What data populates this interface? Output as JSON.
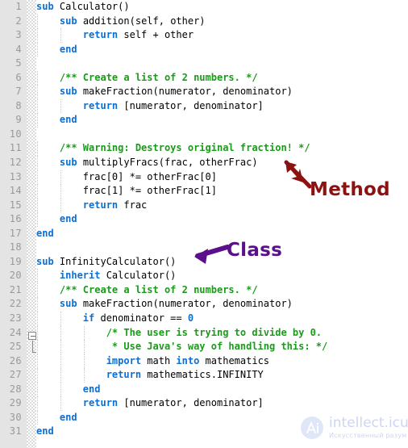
{
  "editor": {
    "language_hint": "pseudocode",
    "total_lines": 31,
    "colors": {
      "background": "#ffffff",
      "gutter_background": "#e4e4e4",
      "line_number": "#999999",
      "keyword": "#0b6fd4",
      "comment": "#1a9b1a",
      "number": "#0b6fd4",
      "identifier": "#000000",
      "indent_guide": "#c9c9c9",
      "annotation_method": "#8c1111",
      "annotation_class": "#5c0f8b",
      "watermark": "#ccd6f2"
    }
  },
  "line_numbers": [
    "1",
    "2",
    "3",
    "4",
    "5",
    "6",
    "7",
    "8",
    "9",
    "10",
    "11",
    "12",
    "13",
    "14",
    "15",
    "16",
    "17",
    "18",
    "19",
    "20",
    "21",
    "22",
    "23",
    "24",
    "25",
    "26",
    "27",
    "28",
    "29",
    "30",
    "31"
  ],
  "code_lines": [
    {
      "n": 1,
      "indent": 0,
      "guides": [],
      "tokens": [
        {
          "t": "kw",
          "v": "sub"
        },
        {
          "t": "id",
          "v": " Calculator()"
        }
      ]
    },
    {
      "n": 2,
      "indent": 1,
      "guides": [
        0
      ],
      "tokens": [
        {
          "t": "kw",
          "v": "sub"
        },
        {
          "t": "id",
          "v": " addition(self, other)"
        }
      ]
    },
    {
      "n": 3,
      "indent": 2,
      "guides": [
        0,
        1
      ],
      "tokens": [
        {
          "t": "kw",
          "v": "return"
        },
        {
          "t": "id",
          "v": " self + other"
        }
      ]
    },
    {
      "n": 4,
      "indent": 1,
      "guides": [
        0
      ],
      "tokens": [
        {
          "t": "kw",
          "v": "end"
        }
      ]
    },
    {
      "n": 5,
      "indent": 0,
      "guides": [],
      "tokens": []
    },
    {
      "n": 6,
      "indent": 1,
      "guides": [
        0
      ],
      "tokens": [
        {
          "t": "cm",
          "v": "/** Create a list of 2 numbers. */"
        }
      ]
    },
    {
      "n": 7,
      "indent": 1,
      "guides": [
        0
      ],
      "tokens": [
        {
          "t": "kw",
          "v": "sub"
        },
        {
          "t": "id",
          "v": " makeFraction(numerator, denominator)"
        }
      ]
    },
    {
      "n": 8,
      "indent": 2,
      "guides": [
        0,
        1
      ],
      "tokens": [
        {
          "t": "kw",
          "v": "return"
        },
        {
          "t": "id",
          "v": " [numerator, denominator]"
        }
      ]
    },
    {
      "n": 9,
      "indent": 1,
      "guides": [
        0
      ],
      "tokens": [
        {
          "t": "kw",
          "v": "end"
        }
      ]
    },
    {
      "n": 10,
      "indent": 0,
      "guides": [],
      "tokens": []
    },
    {
      "n": 11,
      "indent": 1,
      "guides": [
        0
      ],
      "tokens": [
        {
          "t": "cm",
          "v": "/** Warning: Destroys original fraction! */"
        }
      ]
    },
    {
      "n": 12,
      "indent": 1,
      "guides": [
        0
      ],
      "tokens": [
        {
          "t": "kw",
          "v": "sub"
        },
        {
          "t": "id",
          "v": " multiplyFracs(frac, otherFrac)"
        }
      ]
    },
    {
      "n": 13,
      "indent": 2,
      "guides": [
        0,
        1
      ],
      "tokens": [
        {
          "t": "id",
          "v": "frac[0] *= otherFrac[0]"
        }
      ]
    },
    {
      "n": 14,
      "indent": 2,
      "guides": [
        0,
        1
      ],
      "tokens": [
        {
          "t": "id",
          "v": "frac[1] *= otherFrac[1]"
        }
      ]
    },
    {
      "n": 15,
      "indent": 2,
      "guides": [
        0,
        1
      ],
      "tokens": [
        {
          "t": "kw",
          "v": "return"
        },
        {
          "t": "id",
          "v": " frac"
        }
      ]
    },
    {
      "n": 16,
      "indent": 1,
      "guides": [
        0
      ],
      "tokens": [
        {
          "t": "kw",
          "v": "end"
        }
      ]
    },
    {
      "n": 17,
      "indent": 0,
      "guides": [],
      "tokens": [
        {
          "t": "kw",
          "v": "end"
        }
      ]
    },
    {
      "n": 18,
      "indent": 0,
      "guides": [],
      "tokens": []
    },
    {
      "n": 19,
      "indent": 0,
      "guides": [],
      "tokens": [
        {
          "t": "kw",
          "v": "sub"
        },
        {
          "t": "id",
          "v": " InfinityCalculator()"
        }
      ]
    },
    {
      "n": 20,
      "indent": 1,
      "guides": [
        0
      ],
      "tokens": [
        {
          "t": "kw",
          "v": "inherit"
        },
        {
          "t": "id",
          "v": " Calculator()"
        }
      ]
    },
    {
      "n": 21,
      "indent": 1,
      "guides": [
        0
      ],
      "tokens": [
        {
          "t": "cm",
          "v": "/** Create a list of 2 numbers. */"
        }
      ]
    },
    {
      "n": 22,
      "indent": 1,
      "guides": [
        0
      ],
      "tokens": [
        {
          "t": "kw",
          "v": "sub"
        },
        {
          "t": "id",
          "v": " makeFraction(numerator, denominator)"
        }
      ]
    },
    {
      "n": 23,
      "indent": 2,
      "guides": [
        0,
        1
      ],
      "tokens": [
        {
          "t": "kw",
          "v": "if"
        },
        {
          "t": "id",
          "v": " denominator == "
        },
        {
          "t": "num",
          "v": "0"
        }
      ]
    },
    {
      "n": 24,
      "indent": 3,
      "guides": [
        0,
        1,
        2
      ],
      "tokens": [
        {
          "t": "cm",
          "v": "/* The user is trying to divide by 0."
        }
      ]
    },
    {
      "n": 25,
      "indent": 3,
      "guides": [
        0,
        1,
        2
      ],
      "tokens": [
        {
          "t": "cm",
          "v": " * Use Java's way of handling this: */"
        }
      ]
    },
    {
      "n": 26,
      "indent": 3,
      "guides": [
        0,
        1,
        2
      ],
      "tokens": [
        {
          "t": "kw",
          "v": "import"
        },
        {
          "t": "id",
          "v": " math "
        },
        {
          "t": "kw",
          "v": "into"
        },
        {
          "t": "id",
          "v": " mathematics"
        }
      ]
    },
    {
      "n": 27,
      "indent": 3,
      "guides": [
        0,
        1,
        2
      ],
      "tokens": [
        {
          "t": "kw",
          "v": "return"
        },
        {
          "t": "id",
          "v": " mathematics.INFINITY"
        }
      ]
    },
    {
      "n": 28,
      "indent": 2,
      "guides": [
        0,
        1
      ],
      "tokens": [
        {
          "t": "kw",
          "v": "end"
        }
      ]
    },
    {
      "n": 29,
      "indent": 2,
      "guides": [
        0,
        1
      ],
      "tokens": [
        {
          "t": "kw",
          "v": "return"
        },
        {
          "t": "id",
          "v": " [numerator, denominator]"
        }
      ]
    },
    {
      "n": 30,
      "indent": 1,
      "guides": [
        0
      ],
      "tokens": [
        {
          "t": "kw",
          "v": "end"
        }
      ]
    },
    {
      "n": 31,
      "indent": 0,
      "guides": [],
      "tokens": [
        {
          "t": "kw",
          "v": "end"
        }
      ]
    }
  ],
  "annotations": [
    {
      "id": "method",
      "label": "Method",
      "color": "#8c1111",
      "arrow": "arrow-up-left-icon",
      "points_to_line": 12
    },
    {
      "id": "class",
      "label": "Class",
      "color": "#5c0f8b",
      "arrow": "arrow-left-icon",
      "points_to_line": 19
    }
  ],
  "fold_widget": {
    "state": "expanded",
    "glyph": "minus",
    "at_line": 24
  },
  "watermark": {
    "logo_text": "Ai",
    "title": "intellect.icu",
    "subtitle": "Искусственный разум"
  }
}
